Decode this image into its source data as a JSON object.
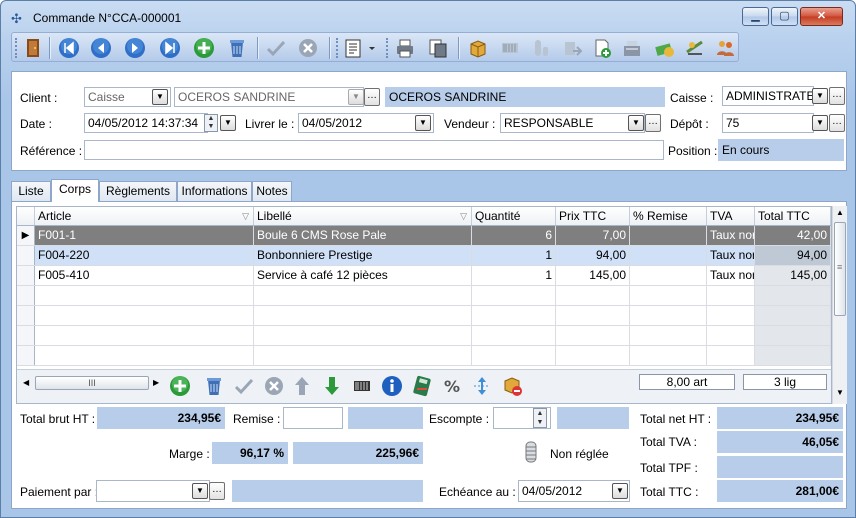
{
  "window": {
    "title": "Commande N°CCA-000001"
  },
  "header": {
    "client_label": "Client :",
    "client_type": "Caisse",
    "client_code": "OCEROS SANDRINE",
    "client_name": "OCEROS SANDRINE",
    "caisse_label": "Caisse :",
    "caisse_value": "ADMINISTRATE",
    "date_label": "Date :",
    "date_value": "04/05/2012 14:37:34",
    "livrer_label": "Livrer le :",
    "livrer_value": "04/05/2012",
    "vendeur_label": "Vendeur :",
    "vendeur_value": "RESPONSABLE",
    "depot_label": "Dépôt :",
    "depot_value": "75",
    "reference_label": "Référence :",
    "reference_value": "",
    "position_label": "Position :",
    "position_value": "En cours"
  },
  "tabs": [
    {
      "label": "Liste"
    },
    {
      "label": "Corps"
    },
    {
      "label": "Règlements"
    },
    {
      "label": "Informations"
    },
    {
      "label": "Notes"
    }
  ],
  "grid": {
    "columns": [
      "Article",
      "Libellé",
      "Quantité",
      "Prix TTC",
      "% Remise",
      "TVA",
      "Total TTC"
    ],
    "rows": [
      {
        "article": "F001-1",
        "libelle": "Boule 6 CMS Rose Pale",
        "quantite": "6",
        "prix": "7,00",
        "remise": "",
        "tva": "Taux nor",
        "total": "42,00"
      },
      {
        "article": "F004-220",
        "libelle": "Bonbonniere Prestige",
        "quantite": "1",
        "prix": "94,00",
        "remise": "",
        "tva": "Taux nor",
        "total": "94,00"
      },
      {
        "article": "F005-410",
        "libelle": "Service à café 12 pièces",
        "quantite": "1",
        "prix": "145,00",
        "remise": "",
        "tva": "Taux nor",
        "total": "145,00"
      }
    ],
    "summary_art": "8,00 art",
    "summary_lig": "3 lig",
    "hscroll_thumb": "III"
  },
  "totals": {
    "brut_ht_label": "Total brut HT :",
    "brut_ht_value": "234,95€",
    "remise_label": "Remise :",
    "remise_value": "",
    "escompte_label": "Escompte :",
    "escompte_value": "",
    "marge_label": "Marge :",
    "marge_pct": "96,17 %",
    "marge_value": "225,96€",
    "reglement_status": "Non réglée",
    "paiement_label": "Paiement par :",
    "paiement_value": "",
    "echeance_label": "Echéance au :",
    "echeance_value": "04/05/2012",
    "net_ht_label": "Total net HT :",
    "net_ht_value": "234,95€",
    "tva_label": "Total TVA :",
    "tva_value": "46,05€",
    "tpf_label": "Total TPF :",
    "tpf_value": "",
    "ttc_label": "Total TTC :",
    "ttc_value": "281,00€"
  },
  "colors": {
    "field_blue": "#b8cde9",
    "row_selected": "#7f7f7f",
    "row_highlight": "#cfe0f7"
  }
}
